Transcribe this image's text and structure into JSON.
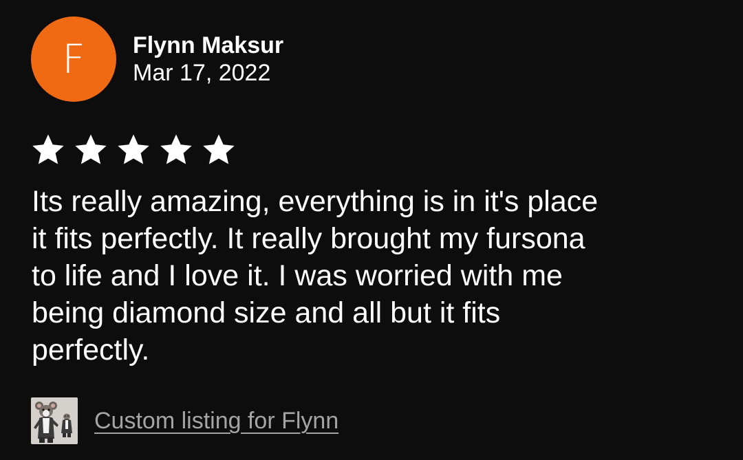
{
  "review": {
    "avatar_initial": "F",
    "avatar_color": "#f06a13",
    "reviewer_name": "Flynn Maksur",
    "date": "Mar 17, 2022",
    "rating": 5,
    "rating_max": 5,
    "text": "Its really amazing, everything is in it's place\nit fits perfectly. It really brought my fursona\nto life and I love it. I was worried with me\nbeing diamond size and all but it fits\nperfectly.",
    "listing": {
      "thumbnail_icon": "listing-thumbnail-image",
      "link_text": "Custom listing for Flynn"
    }
  },
  "colors": {
    "background": "#0d0d0d",
    "text": "#ffffff",
    "link": "#a5a5a5",
    "star": "#ffffff"
  }
}
